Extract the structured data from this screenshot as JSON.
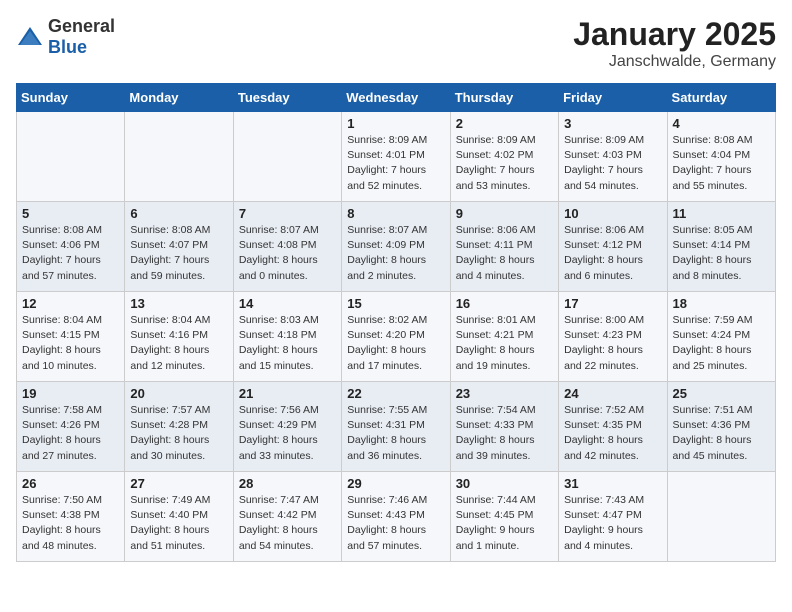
{
  "header": {
    "logo_general": "General",
    "logo_blue": "Blue",
    "month": "January 2025",
    "location": "Janschwalde, Germany"
  },
  "weekdays": [
    "Sunday",
    "Monday",
    "Tuesday",
    "Wednesday",
    "Thursday",
    "Friday",
    "Saturday"
  ],
  "weeks": [
    [
      {
        "day": "",
        "info": ""
      },
      {
        "day": "",
        "info": ""
      },
      {
        "day": "",
        "info": ""
      },
      {
        "day": "1",
        "info": "Sunrise: 8:09 AM\nSunset: 4:01 PM\nDaylight: 7 hours\nand 52 minutes."
      },
      {
        "day": "2",
        "info": "Sunrise: 8:09 AM\nSunset: 4:02 PM\nDaylight: 7 hours\nand 53 minutes."
      },
      {
        "day": "3",
        "info": "Sunrise: 8:09 AM\nSunset: 4:03 PM\nDaylight: 7 hours\nand 54 minutes."
      },
      {
        "day": "4",
        "info": "Sunrise: 8:08 AM\nSunset: 4:04 PM\nDaylight: 7 hours\nand 55 minutes."
      }
    ],
    [
      {
        "day": "5",
        "info": "Sunrise: 8:08 AM\nSunset: 4:06 PM\nDaylight: 7 hours\nand 57 minutes."
      },
      {
        "day": "6",
        "info": "Sunrise: 8:08 AM\nSunset: 4:07 PM\nDaylight: 7 hours\nand 59 minutes."
      },
      {
        "day": "7",
        "info": "Sunrise: 8:07 AM\nSunset: 4:08 PM\nDaylight: 8 hours\nand 0 minutes."
      },
      {
        "day": "8",
        "info": "Sunrise: 8:07 AM\nSunset: 4:09 PM\nDaylight: 8 hours\nand 2 minutes."
      },
      {
        "day": "9",
        "info": "Sunrise: 8:06 AM\nSunset: 4:11 PM\nDaylight: 8 hours\nand 4 minutes."
      },
      {
        "day": "10",
        "info": "Sunrise: 8:06 AM\nSunset: 4:12 PM\nDaylight: 8 hours\nand 6 minutes."
      },
      {
        "day": "11",
        "info": "Sunrise: 8:05 AM\nSunset: 4:14 PM\nDaylight: 8 hours\nand 8 minutes."
      }
    ],
    [
      {
        "day": "12",
        "info": "Sunrise: 8:04 AM\nSunset: 4:15 PM\nDaylight: 8 hours\nand 10 minutes."
      },
      {
        "day": "13",
        "info": "Sunrise: 8:04 AM\nSunset: 4:16 PM\nDaylight: 8 hours\nand 12 minutes."
      },
      {
        "day": "14",
        "info": "Sunrise: 8:03 AM\nSunset: 4:18 PM\nDaylight: 8 hours\nand 15 minutes."
      },
      {
        "day": "15",
        "info": "Sunrise: 8:02 AM\nSunset: 4:20 PM\nDaylight: 8 hours\nand 17 minutes."
      },
      {
        "day": "16",
        "info": "Sunrise: 8:01 AM\nSunset: 4:21 PM\nDaylight: 8 hours\nand 19 minutes."
      },
      {
        "day": "17",
        "info": "Sunrise: 8:00 AM\nSunset: 4:23 PM\nDaylight: 8 hours\nand 22 minutes."
      },
      {
        "day": "18",
        "info": "Sunrise: 7:59 AM\nSunset: 4:24 PM\nDaylight: 8 hours\nand 25 minutes."
      }
    ],
    [
      {
        "day": "19",
        "info": "Sunrise: 7:58 AM\nSunset: 4:26 PM\nDaylight: 8 hours\nand 27 minutes."
      },
      {
        "day": "20",
        "info": "Sunrise: 7:57 AM\nSunset: 4:28 PM\nDaylight: 8 hours\nand 30 minutes."
      },
      {
        "day": "21",
        "info": "Sunrise: 7:56 AM\nSunset: 4:29 PM\nDaylight: 8 hours\nand 33 minutes."
      },
      {
        "day": "22",
        "info": "Sunrise: 7:55 AM\nSunset: 4:31 PM\nDaylight: 8 hours\nand 36 minutes."
      },
      {
        "day": "23",
        "info": "Sunrise: 7:54 AM\nSunset: 4:33 PM\nDaylight: 8 hours\nand 39 minutes."
      },
      {
        "day": "24",
        "info": "Sunrise: 7:52 AM\nSunset: 4:35 PM\nDaylight: 8 hours\nand 42 minutes."
      },
      {
        "day": "25",
        "info": "Sunrise: 7:51 AM\nSunset: 4:36 PM\nDaylight: 8 hours\nand 45 minutes."
      }
    ],
    [
      {
        "day": "26",
        "info": "Sunrise: 7:50 AM\nSunset: 4:38 PM\nDaylight: 8 hours\nand 48 minutes."
      },
      {
        "day": "27",
        "info": "Sunrise: 7:49 AM\nSunset: 4:40 PM\nDaylight: 8 hours\nand 51 minutes."
      },
      {
        "day": "28",
        "info": "Sunrise: 7:47 AM\nSunset: 4:42 PM\nDaylight: 8 hours\nand 54 minutes."
      },
      {
        "day": "29",
        "info": "Sunrise: 7:46 AM\nSunset: 4:43 PM\nDaylight: 8 hours\nand 57 minutes."
      },
      {
        "day": "30",
        "info": "Sunrise: 7:44 AM\nSunset: 4:45 PM\nDaylight: 9 hours\nand 1 minute."
      },
      {
        "day": "31",
        "info": "Sunrise: 7:43 AM\nSunset: 4:47 PM\nDaylight: 9 hours\nand 4 minutes."
      },
      {
        "day": "",
        "info": ""
      }
    ]
  ]
}
